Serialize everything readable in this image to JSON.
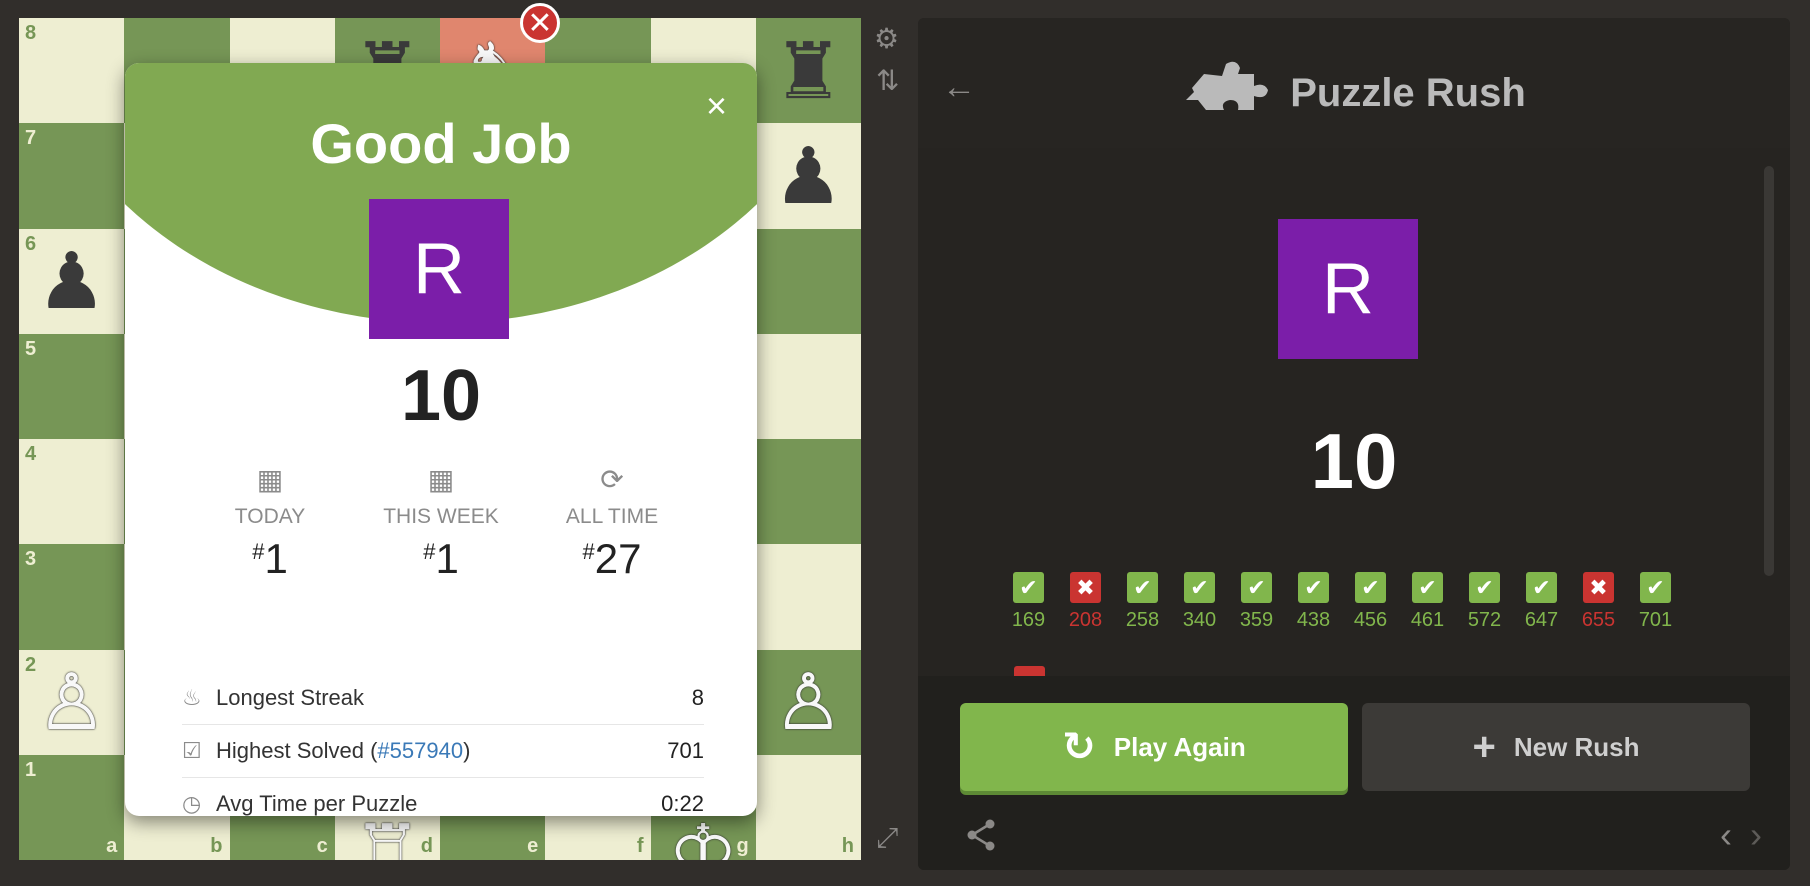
{
  "board": {
    "ranks": [
      "8",
      "7",
      "6",
      "5",
      "4",
      "3",
      "2",
      "1"
    ],
    "files": [
      "a",
      "b",
      "c",
      "d",
      "e",
      "f",
      "g",
      "h"
    ],
    "pieces": [
      {
        "square": "d8",
        "glyph": "♜",
        "color": "black",
        "name": "black-rook-d8-icon",
        "partial": "top"
      },
      {
        "square": "e8",
        "glyph": "♞",
        "color": "white",
        "name": "white-knight-e8-icon",
        "partial": "top"
      },
      {
        "square": "h8",
        "glyph": "♜",
        "color": "black",
        "name": "black-rook-h8-icon"
      },
      {
        "square": "h7",
        "glyph": "♟",
        "color": "black",
        "name": "black-pawn-h7-icon"
      },
      {
        "square": "a6",
        "glyph": "♟",
        "color": "black",
        "name": "black-pawn-a6-icon"
      },
      {
        "square": "a2",
        "glyph": "♙",
        "color": "white",
        "name": "white-pawn-a2-icon"
      },
      {
        "square": "h2",
        "glyph": "♙",
        "color": "white",
        "name": "white-pawn-h2-icon"
      },
      {
        "square": "d1",
        "glyph": "♖",
        "color": "white",
        "name": "white-rook-d1-icon",
        "partial": "bottom"
      },
      {
        "square": "g1",
        "glyph": "♔",
        "color": "white",
        "name": "white-king-g1-icon",
        "partial": "bottom"
      }
    ],
    "highlight": "e8",
    "miss_mark": "✕",
    "colors": {
      "light": "#eeeed2",
      "dark": "#769656",
      "highlight": "#e0866e"
    }
  },
  "modal": {
    "title": "Good Job",
    "close": "×",
    "avatar_letter": "R",
    "score": "10",
    "ranks": [
      {
        "label": "TODAY",
        "hash": "#",
        "value": "1",
        "icon": "calendar-icon",
        "glyph": "▦"
      },
      {
        "label": "THIS WEEK",
        "hash": "#",
        "value": "1",
        "icon": "calendar-icon",
        "glyph": "▦"
      },
      {
        "label": "ALL TIME",
        "hash": "#",
        "value": "27",
        "icon": "refresh-icon",
        "glyph": "⟳"
      }
    ],
    "stats": [
      {
        "icon": "flame-icon",
        "glyph": "♨",
        "label": "Longest Streak",
        "value": "8"
      },
      {
        "icon": "checkbox-icon",
        "glyph": "☑",
        "label_prefix": "Highest Solved (",
        "link": "#557940",
        "label_suffix": ")",
        "value": "701"
      },
      {
        "icon": "clock-icon",
        "glyph": "◷",
        "label": "Avg Time per Puzzle",
        "value": "0:22"
      }
    ],
    "colors": {
      "header": "#81a952",
      "avatar": "#7b1ea9",
      "link": "#3a79b7"
    }
  },
  "side_icons": {
    "settings": "⚙",
    "flip": "⇅",
    "expand": "⤢"
  },
  "panel": {
    "back": "←",
    "title": "Puzzle Rush",
    "title_icon": "puzzle-piece-icon",
    "avatar_letter": "R",
    "score": "10",
    "results": [
      {
        "ok": true,
        "rating": "169"
      },
      {
        "ok": false,
        "rating": "208"
      },
      {
        "ok": true,
        "rating": "258"
      },
      {
        "ok": true,
        "rating": "340"
      },
      {
        "ok": true,
        "rating": "359"
      },
      {
        "ok": true,
        "rating": "438"
      },
      {
        "ok": true,
        "rating": "456"
      },
      {
        "ok": true,
        "rating": "461"
      },
      {
        "ok": true,
        "rating": "572"
      },
      {
        "ok": true,
        "rating": "647"
      },
      {
        "ok": false,
        "rating": "655"
      },
      {
        "ok": true,
        "rating": "701"
      }
    ],
    "check_glyph": "✔",
    "cross_glyph": "✖",
    "play_again": {
      "label": "Play Again",
      "glyph": "↻"
    },
    "new_rush": {
      "label": "New Rush",
      "glyph": "+"
    },
    "share_glyph": "≺",
    "prev_glyph": "‹",
    "next_glyph": "›",
    "colors": {
      "success": "#81b64c",
      "fail": "#ca3431"
    }
  }
}
